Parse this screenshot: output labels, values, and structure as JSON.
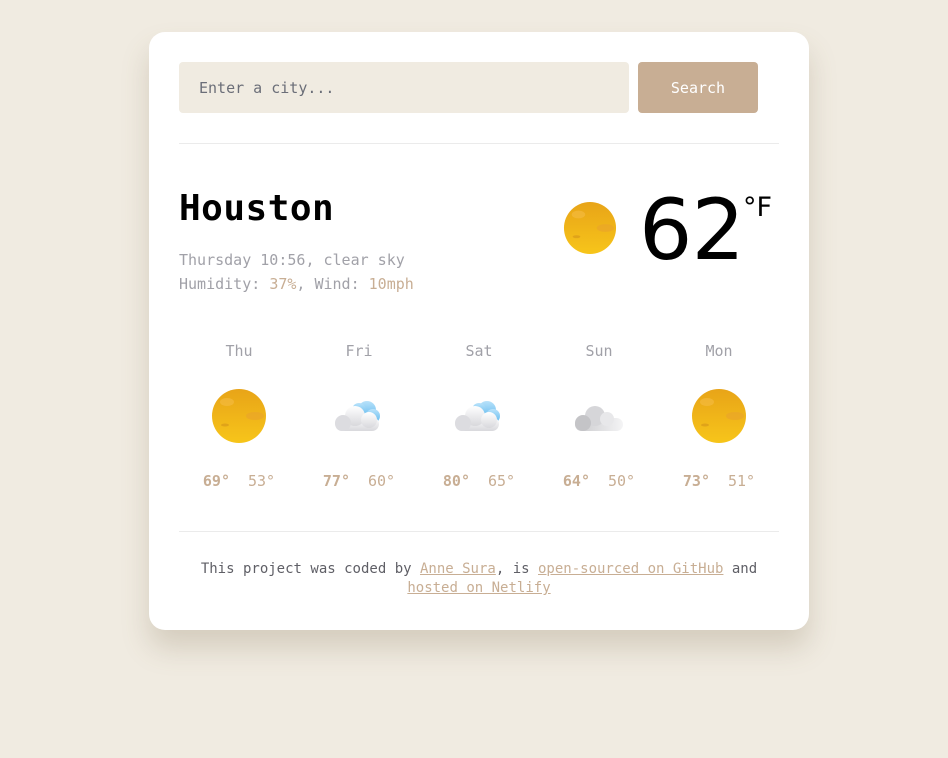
{
  "search": {
    "placeholder": "Enter a city...",
    "button_label": "Search"
  },
  "current": {
    "city": "Houston",
    "datetime": "Thursday 10:56",
    "description": "clear sky",
    "humidity_label": "Humidity:",
    "humidity": "37%",
    "wind_label": "Wind:",
    "wind": "10mph",
    "temperature": "62",
    "unit": "°F",
    "icon": "sun-icon"
  },
  "forecast": [
    {
      "day": "Thu",
      "max": "69°",
      "min": "53°",
      "icon": "sun-icon"
    },
    {
      "day": "Fri",
      "max": "77°",
      "min": "60°",
      "icon": "cloud-icon"
    },
    {
      "day": "Sat",
      "max": "80°",
      "min": "65°",
      "icon": "cloud-icon"
    },
    {
      "day": "Sun",
      "max": "64°",
      "min": "50°",
      "icon": "grey-cloud-icon"
    },
    {
      "day": "Mon",
      "max": "73°",
      "min": "51°",
      "icon": "sun-icon"
    }
  ],
  "footer": {
    "prefix": "This project was coded by",
    "author": "Anne Sura",
    "mid": ", is",
    "github_link": "open-sourced on GitHub",
    "and": "and",
    "netlify_link": "hosted on Netlify"
  },
  "colors": {
    "accent": "#c8ae94",
    "background": "#f0ebe1",
    "input_bg": "#f0ebe1",
    "muted": "#a1a1a8"
  }
}
